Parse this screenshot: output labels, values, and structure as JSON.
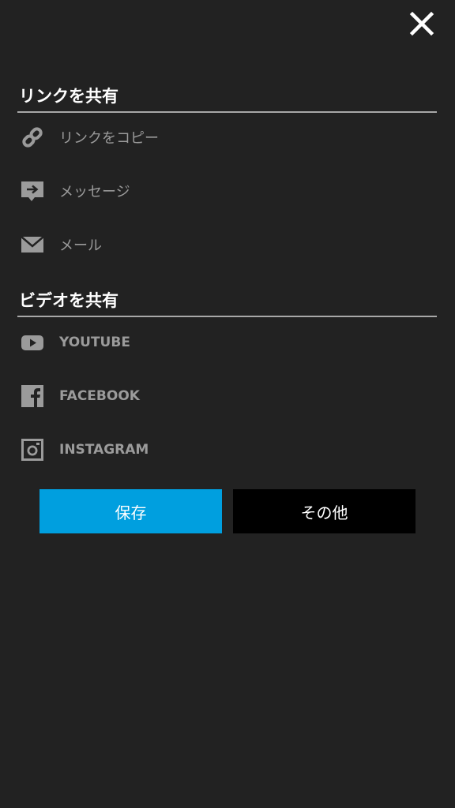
{
  "colors": {
    "background": "#222222",
    "primary_button": "#009fdf",
    "secondary_button": "#000000",
    "item_text": "#9b9b9b",
    "icon": "#9b9b9b"
  },
  "close": {
    "icon": "close-icon"
  },
  "share_link": {
    "title": "リンクを共有",
    "items": [
      {
        "label": "リンクをコピー",
        "icon": "link-icon"
      },
      {
        "label": "メッセージ",
        "icon": "message-icon"
      },
      {
        "label": "メール",
        "icon": "mail-icon"
      }
    ]
  },
  "share_video": {
    "title": "ビデオを共有",
    "items": [
      {
        "label": "YOUTUBE",
        "icon": "youtube-icon"
      },
      {
        "label": "FACEBOOK",
        "icon": "facebook-icon"
      },
      {
        "label": "INSTAGRAM",
        "icon": "instagram-icon"
      }
    ]
  },
  "actions": {
    "save_label": "保存",
    "other_label": "その他"
  }
}
